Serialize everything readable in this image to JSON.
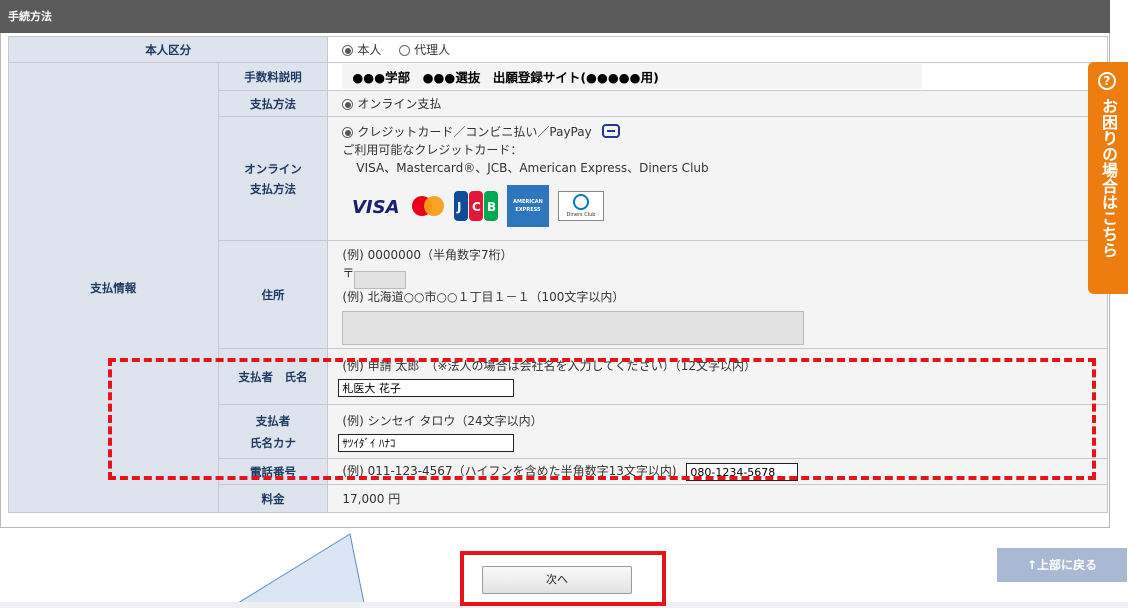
{
  "section_title": "手続方法",
  "rows": {
    "identity": {
      "label": "本人区分",
      "options": [
        "本人",
        "代理人"
      ],
      "selected": "本人"
    },
    "group_label": "支払情報",
    "fee_description": {
      "label": "手数料説明",
      "value": "●●●学部　●●●選抜　出願登録サイト(●●●●●用)"
    },
    "payment_method": {
      "label": "支払方法",
      "value": "オンライン支払"
    },
    "online_method": {
      "label_line1": "オンライン",
      "label_line2": "支払方法",
      "option": "クレジットカード／コンビニ払い／PayPay",
      "cards_caption": "ご利用可能なクレジットカード：",
      "cards_list": "VISA、Mastercard®、JCB、American Express、Diners Club",
      "logos": [
        "VISA",
        "Mastercard",
        "JCB",
        "AMERICAN EXPRESS",
        "Diners Club"
      ]
    },
    "address": {
      "label": "住所",
      "zip_example": "(例) 0000000（半角数字7桁）",
      "zip_mark": "〒",
      "address_example": "(例) 北海道○○市○○１丁目１－１（100文字以内）"
    },
    "payer_name": {
      "label": "支払者　氏名",
      "example": "(例) 申請 太郎　（※法人の場合は会社名を入力してください）（12文字以内）",
      "value": "札医大 花子"
    },
    "payer_kana": {
      "label_line1": "支払者",
      "label_line2": "氏名カナ",
      "example": "(例) シンセイ タロウ（24文字以内）",
      "value": "ｻﾂｲﾀﾞｲ ﾊﾅｺ"
    },
    "phone": {
      "label": "電話番号",
      "example": "(例) 011-123-4567（ハイフンを含めた半角数字13文字以内)",
      "value": "080-1234-5678"
    },
    "fee": {
      "label": "料金",
      "value": "17,000 円"
    }
  },
  "side_help": {
    "icon": "question-circle-icon",
    "text": "お困りの場合はこちら"
  },
  "next_button": "次へ",
  "back_to_top": "↑上部に戻る",
  "colors": {
    "header": "#5b5b5b",
    "label_bg": "#dde4ee",
    "label_text": "#1f3a62",
    "help_tab": "#ee7d10",
    "highlight": "#e5141a",
    "top_button": "#a9b8d3"
  }
}
